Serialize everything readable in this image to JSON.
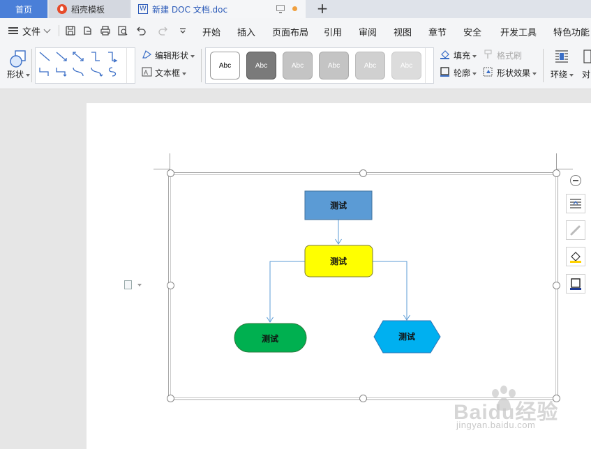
{
  "tabs": {
    "home": "首页",
    "template": "稻壳模板",
    "document": "新建 DOC 文档.doc",
    "add": "+"
  },
  "menu": {
    "file": "文件",
    "items": [
      "开始",
      "插入",
      "页面布局",
      "引用",
      "审阅",
      "视图",
      "章节",
      "安全",
      "开发工具",
      "特色功能"
    ]
  },
  "ribbon": {
    "shape_label": "形状",
    "edit_shape": "编辑形状",
    "text_box": "文本框",
    "styles": [
      "Abc",
      "Abc",
      "Abc",
      "Abc",
      "Abc",
      "Abc"
    ],
    "fill": "填充",
    "format_painter": "格式刷",
    "outline": "轮廓",
    "shape_effects": "形状效果",
    "wrap": "环绕",
    "align": "对"
  },
  "diagram": {
    "nodes": [
      {
        "label": "测试",
        "shape": "rectangle",
        "color": "#5b9bd5"
      },
      {
        "label": "测试",
        "shape": "rounded-rectangle",
        "color": "#ffff00"
      },
      {
        "label": "测试",
        "shape": "terminator",
        "color": "#00b050"
      },
      {
        "label": "测试",
        "shape": "hexagon",
        "color": "#00b0f0"
      }
    ],
    "connector_color": "#5b9bd5"
  },
  "colors": {
    "tab_active": "#4a7fd8",
    "toolbar_bg": "#f4f5f7",
    "canvas_bg": "#e6e6e6"
  },
  "watermark": {
    "brand": "Baidu经验",
    "url": "jingyan.baidu.com"
  }
}
